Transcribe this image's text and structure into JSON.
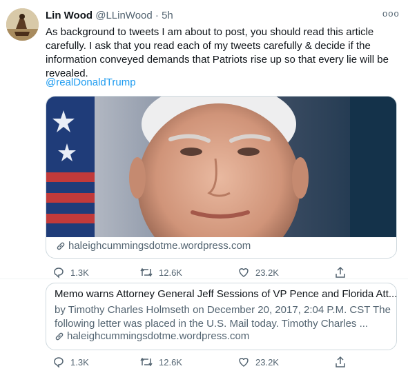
{
  "author": {
    "name": "Lin Wood",
    "handle": "@LLinWood",
    "dot": "·",
    "time": "5h"
  },
  "tweet": {
    "text": "As background to tweets I am about to post, you should read this article carefully. I ask that you read each of my tweets carefully & decide if the information conveyed demands that Patriots rise up so that every lie will be revealed.",
    "mention": "@realDonaldTrump",
    "more_icon": "more-icon",
    "more_label": "ooo"
  },
  "card": {
    "domain": "haleighcummingsdotme.wordpress.com"
  },
  "actions": {
    "reply": "1.3K",
    "retweet": "12.6K",
    "like": "23.2K"
  },
  "card2": {
    "title": "Memo warns Attorney General Jeff Sessions of VP Pence and Florida Att...",
    "description": "by Timothy Charles Holmseth on December 20, 2017, 2:04 P.M. CST The following letter was placed in the U.S. Mail today. Timothy Charles ...",
    "domain": "haleighcummingsdotme.wordpress.com"
  },
  "actions2": {
    "reply": "1.3K",
    "retweet": "12.6K",
    "like": "23.2K"
  },
  "colors": {
    "accent": "#1d9bf0",
    "secondary_text": "#536471",
    "border": "#cfd9de"
  }
}
